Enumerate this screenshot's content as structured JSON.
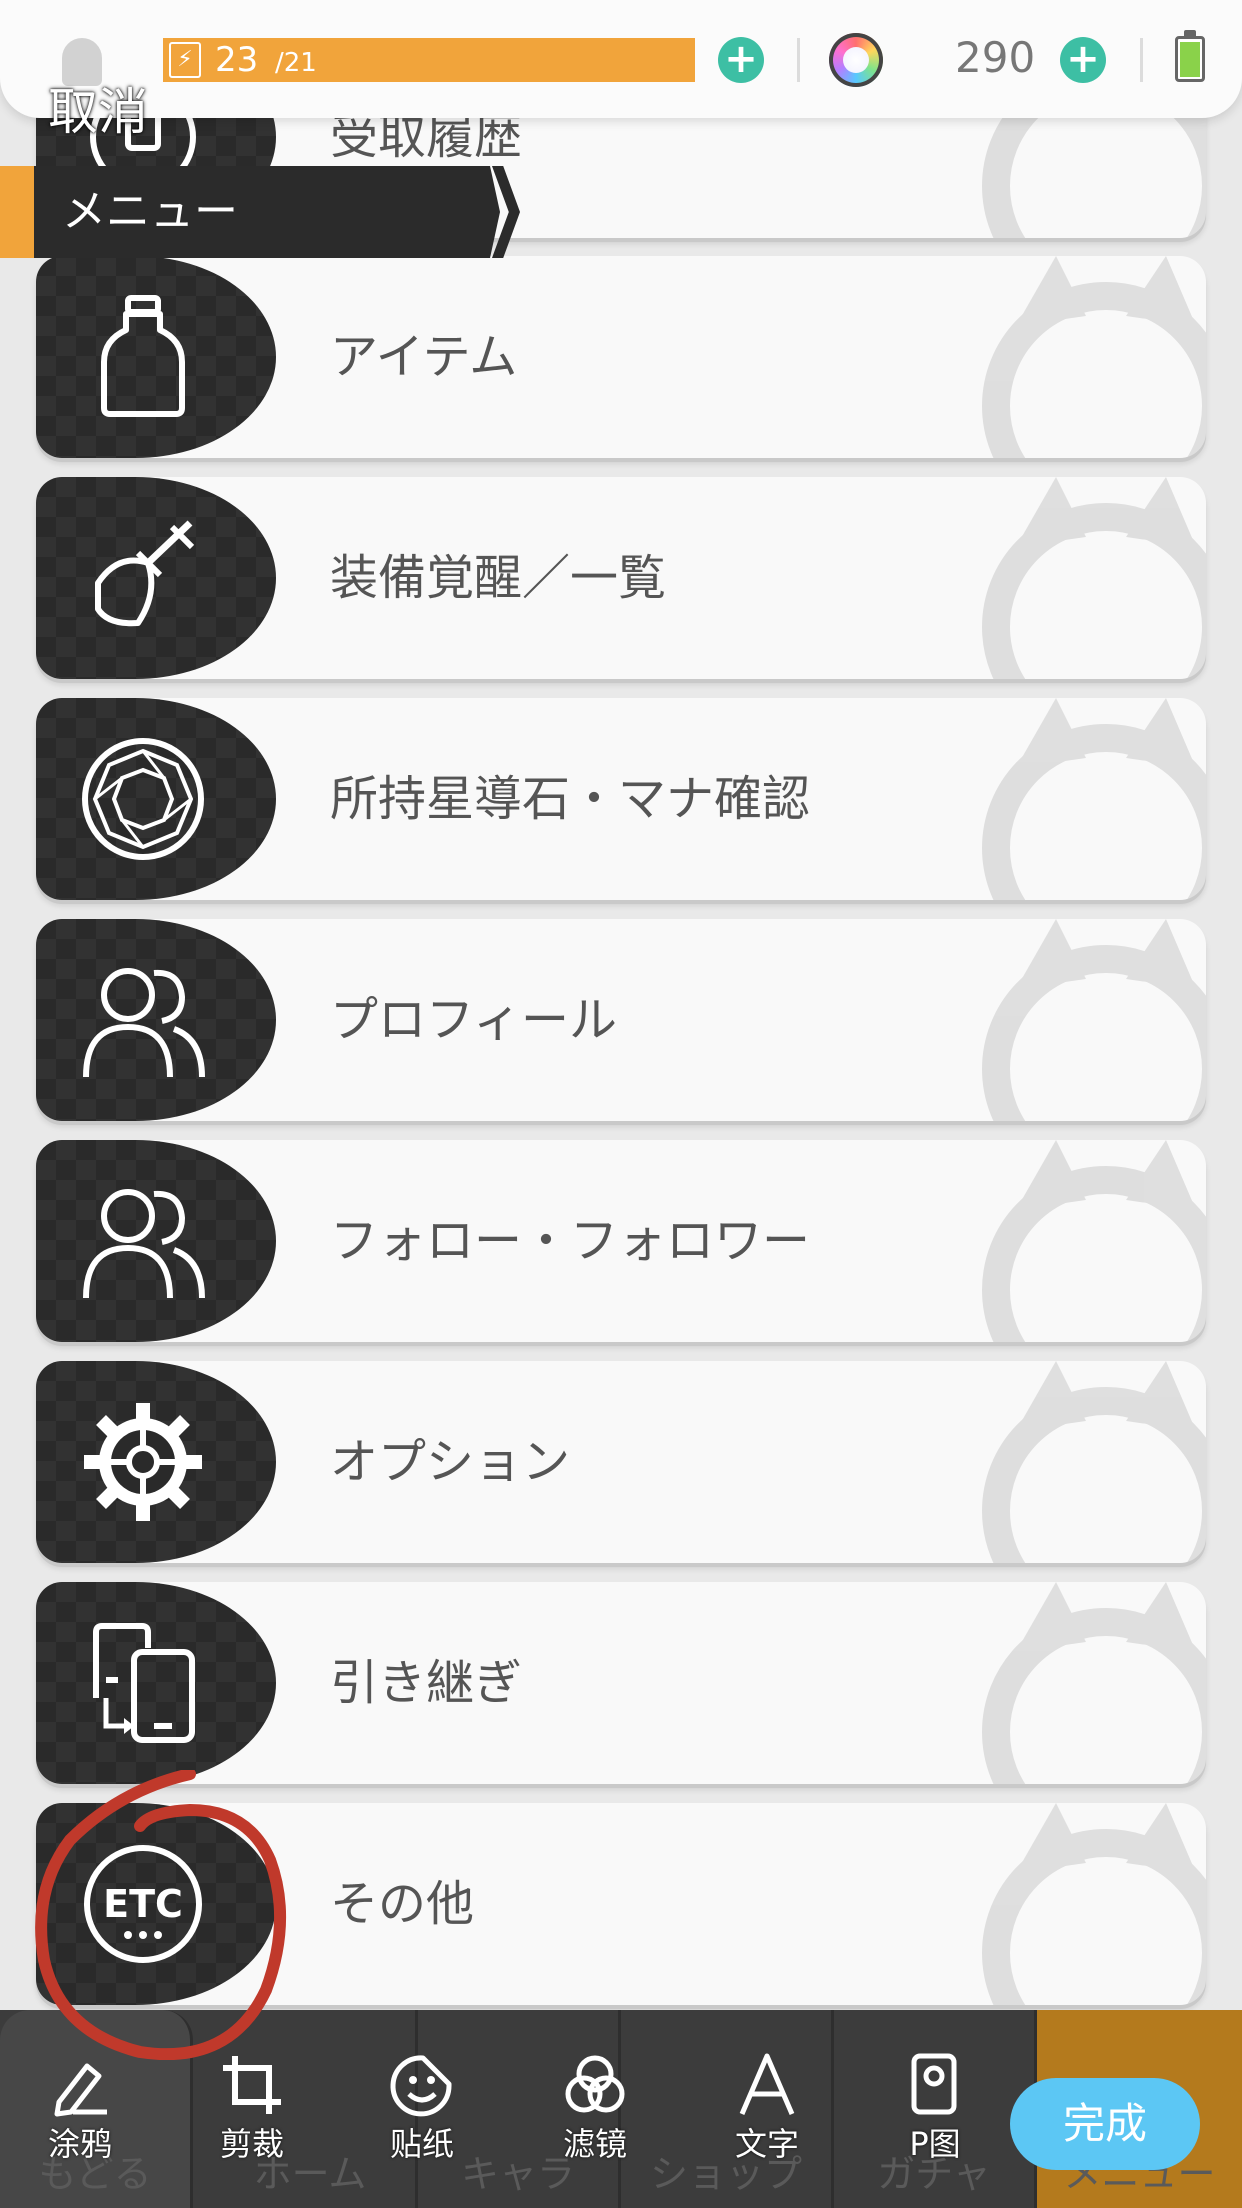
{
  "status": {
    "stamina_current": "23",
    "stamina_max": "/21",
    "gem_count": "290",
    "cancel_label": "取消"
  },
  "menu": {
    "header_title": "メニュー",
    "partial_item_label": "受取履歴",
    "items": [
      {
        "label": "アイテム",
        "icon": "bottle-icon"
      },
      {
        "label": "装備覚醒／一覧",
        "icon": "shield-sword-icon"
      },
      {
        "label": "所持星導石・マナ確認",
        "icon": "gem-icon"
      },
      {
        "label": "プロフィール",
        "icon": "users-icon"
      },
      {
        "label": "フォロー・フォロワー",
        "icon": "users-icon"
      },
      {
        "label": "オプション",
        "icon": "gear-icon"
      },
      {
        "label": "引き継ぎ",
        "icon": "device-transfer-icon"
      },
      {
        "label": "その他",
        "icon": "etc-icon"
      }
    ]
  },
  "game_nav": {
    "items": [
      "もどる",
      "ホーム",
      "キャラ",
      "ショップ",
      "ガチャ",
      "メニュー"
    ]
  },
  "editor_toolbar": {
    "tools": [
      {
        "label": "涂鸦",
        "icon": "pen-icon"
      },
      {
        "label": "剪裁",
        "icon": "crop-icon"
      },
      {
        "label": "贴纸",
        "icon": "sticker-icon"
      },
      {
        "label": "滤镜",
        "icon": "filter-icon"
      },
      {
        "label": "文字",
        "icon": "text-icon"
      },
      {
        "label": "P图",
        "icon": "p-image-icon"
      }
    ],
    "done_label": "完成"
  },
  "colors": {
    "stamina": "#f1a43b",
    "plus_button": "#3dbfa4",
    "done_button": "#5cc7f4",
    "annotation": "#c0392b"
  }
}
